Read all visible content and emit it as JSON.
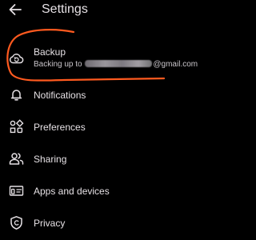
{
  "header": {
    "title": "Settings",
    "back_icon": "arrow-back-icon"
  },
  "backup": {
    "label": "Backup",
    "subtitle_prefix": "Backing up to",
    "subtitle_suffix": "@gmail.com",
    "icon": "cloud-sync-icon"
  },
  "menu": {
    "items": [
      {
        "label": "Notifications",
        "icon": "bell-icon"
      },
      {
        "label": "Preferences",
        "icon": "preferences-shapes-icon"
      },
      {
        "label": "Sharing",
        "icon": "people-icon"
      },
      {
        "label": "Apps and devices",
        "icon": "devices-icon"
      },
      {
        "label": "Privacy",
        "icon": "shield-icon"
      }
    ]
  },
  "colors": {
    "background": "#000000",
    "text_primary": "#e6e1e5",
    "text_secondary": "#c9c5ca",
    "annotation": "#ff5a1f"
  }
}
